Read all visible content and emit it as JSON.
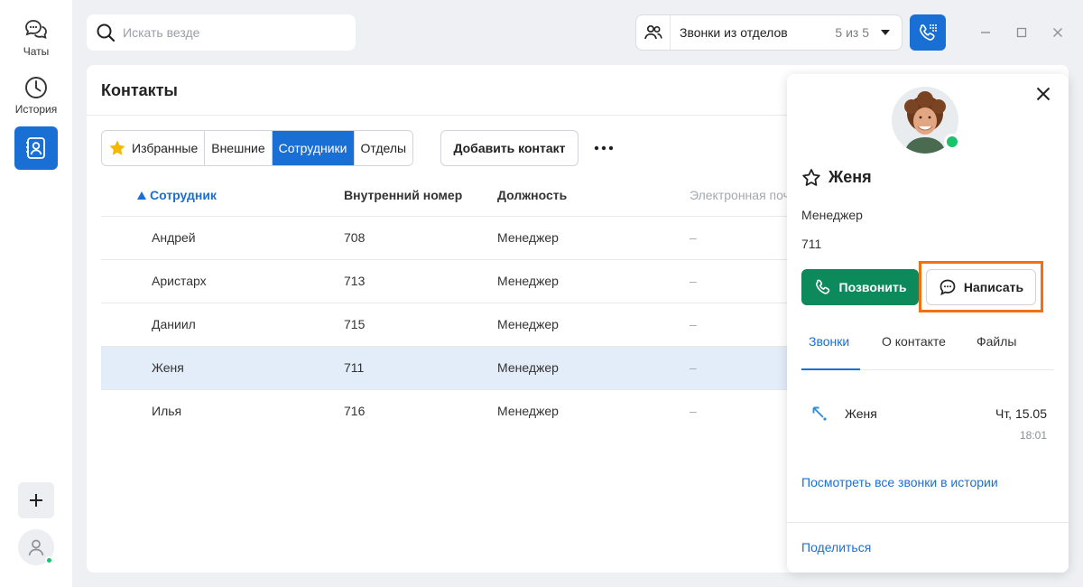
{
  "sidebar": {
    "items": [
      {
        "label": "Чаты",
        "icon": "chats-icon"
      },
      {
        "label": "История",
        "icon": "history-clock-icon"
      },
      {
        "label": "",
        "icon": "contacts-book-icon"
      }
    ],
    "add_icon": "plus-icon",
    "avatar_icon": "user-icon"
  },
  "search": {
    "placeholder": "Искать везде"
  },
  "dept_filter": {
    "label": "Звонки из отделов",
    "count": "5 из 5"
  },
  "contacts": {
    "title": "Контакты",
    "segments": [
      "Избранные",
      "Внешние",
      "Сотрудники",
      "Отделы"
    ],
    "active_segment": "Сотрудники",
    "add_contact_label": "Добавить контакт",
    "columns": [
      "Сотрудник",
      "Внутренний номер",
      "Должность",
      "Электронная поч"
    ],
    "rows": [
      {
        "name": "Андрей",
        "ext": "708",
        "role": "Менеджер",
        "email": "–"
      },
      {
        "name": "Аристарх",
        "ext": "713",
        "role": "Менеджер",
        "email": "–"
      },
      {
        "name": "Даниил",
        "ext": "715",
        "role": "Менеджер",
        "email": "–"
      },
      {
        "name": "Женя",
        "ext": "711",
        "role": "Менеджер",
        "email": "–"
      },
      {
        "name": "Илья",
        "ext": "716",
        "role": "Менеджер",
        "email": "–"
      }
    ]
  },
  "detail": {
    "name": "Женя",
    "role": "Менеджер",
    "ext": "711",
    "call_label": "Позвонить",
    "write_label": "Написать",
    "tabs": [
      "Звонки",
      "О контакте",
      "Файлы"
    ],
    "history": {
      "name": "Женя",
      "date": "Чт, 15.05",
      "time": "18:01"
    },
    "see_all": "Посмотреть все звонки в истории",
    "share": "Поделиться"
  },
  "colors": {
    "accent": "#1a6fd4",
    "call_green": "#0c8a5b",
    "highlight": "#f07114",
    "online": "#19c36b",
    "selected_row": "#e3edf9"
  }
}
